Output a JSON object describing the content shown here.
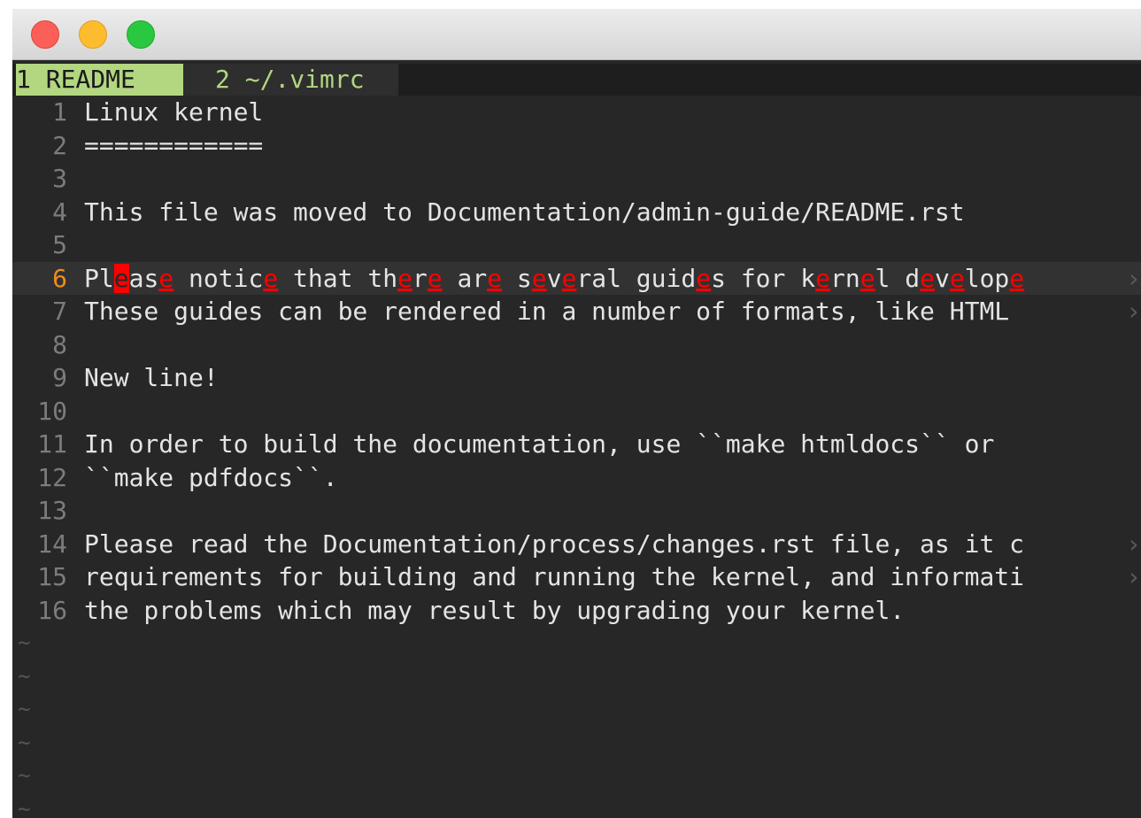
{
  "tabs": [
    {
      "label": "1 README",
      "active": true
    },
    {
      "label": "2 ~/.vimrc",
      "active": false
    }
  ],
  "current_line": 6,
  "lines": [
    {
      "num": "1",
      "text": "Linux kernel"
    },
    {
      "num": "2",
      "text": "============"
    },
    {
      "num": "3",
      "text": ""
    },
    {
      "num": "4",
      "text": "This file was moved to Documentation/admin-guide/README.rst"
    },
    {
      "num": "5",
      "text": ""
    },
    {
      "num": "6",
      "text": "Please notice that there are several guides for kernel develope",
      "overflow": "›"
    },
    {
      "num": "7",
      "text": "These guides can be rendered in a number of formats, like HTML ",
      "overflow": "›"
    },
    {
      "num": "8",
      "text": ""
    },
    {
      "num": "9",
      "text": "New line!"
    },
    {
      "num": "10",
      "text": ""
    },
    {
      "num": "11",
      "text": "In order to build the documentation, use ``make htmldocs`` or"
    },
    {
      "num": "12",
      "text": "``make pdfdocs``."
    },
    {
      "num": "13",
      "text": ""
    },
    {
      "num": "14",
      "text": "Please read the Documentation/process/changes.rst file, as it c",
      "overflow": "›"
    },
    {
      "num": "15",
      "text": "requirements for building and running the kernel, and informati",
      "overflow": "›"
    },
    {
      "num": "16",
      "text": "the problems which may result by upgrading your kernel."
    }
  ],
  "empty_line_marker": "~",
  "empty_line_count": 6,
  "colors": {
    "background": "#272727",
    "line_number": "#7c7c7c",
    "current_line_number": "#f08c1c",
    "search_highlight": "#ff0000",
    "active_tab": "#b3d681"
  }
}
